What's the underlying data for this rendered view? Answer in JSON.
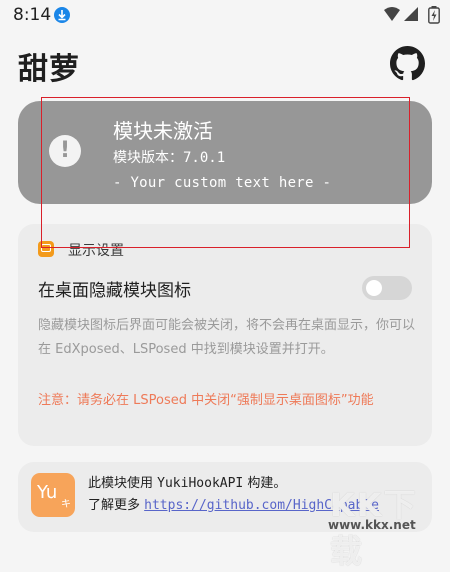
{
  "status_bar": {
    "time": "8:14"
  },
  "header": {
    "title": "甜萝"
  },
  "module_status": {
    "title": "模块未激活",
    "version": "模块版本：7.0.1",
    "custom_text": "- Your custom text here -"
  },
  "display_settings": {
    "section_title": "显示设置",
    "hide_icon_label": "在桌面隐藏模块图标",
    "hide_icon_enabled": false,
    "description": "隐藏模块图标后界面可能会被关闭，将不会再在桌面显示，你可以在 EdXposed、LSPosed 中找到模块设置并打开。",
    "warning": "注意：请务必在 LSPosed 中关闭“强制显示桌面图标”功能"
  },
  "about": {
    "logo_text_main": "Yu",
    "logo_text_sub": "キ",
    "line1_prefix": "此模块使用",
    "line1_api": "YukiHookAPI",
    "line1_suffix": "构建。",
    "learn_more": "了解更多",
    "link": "https://github.com/HighCapable"
  },
  "watermark": {
    "text": "KK下载",
    "url": "www.kkx.net"
  },
  "colors": {
    "status_card_bg": "#979797",
    "accent_orange": "#f39a1b",
    "warning_text": "#ee7a58",
    "link": "#5865c9",
    "annotation": "#d9202a"
  }
}
